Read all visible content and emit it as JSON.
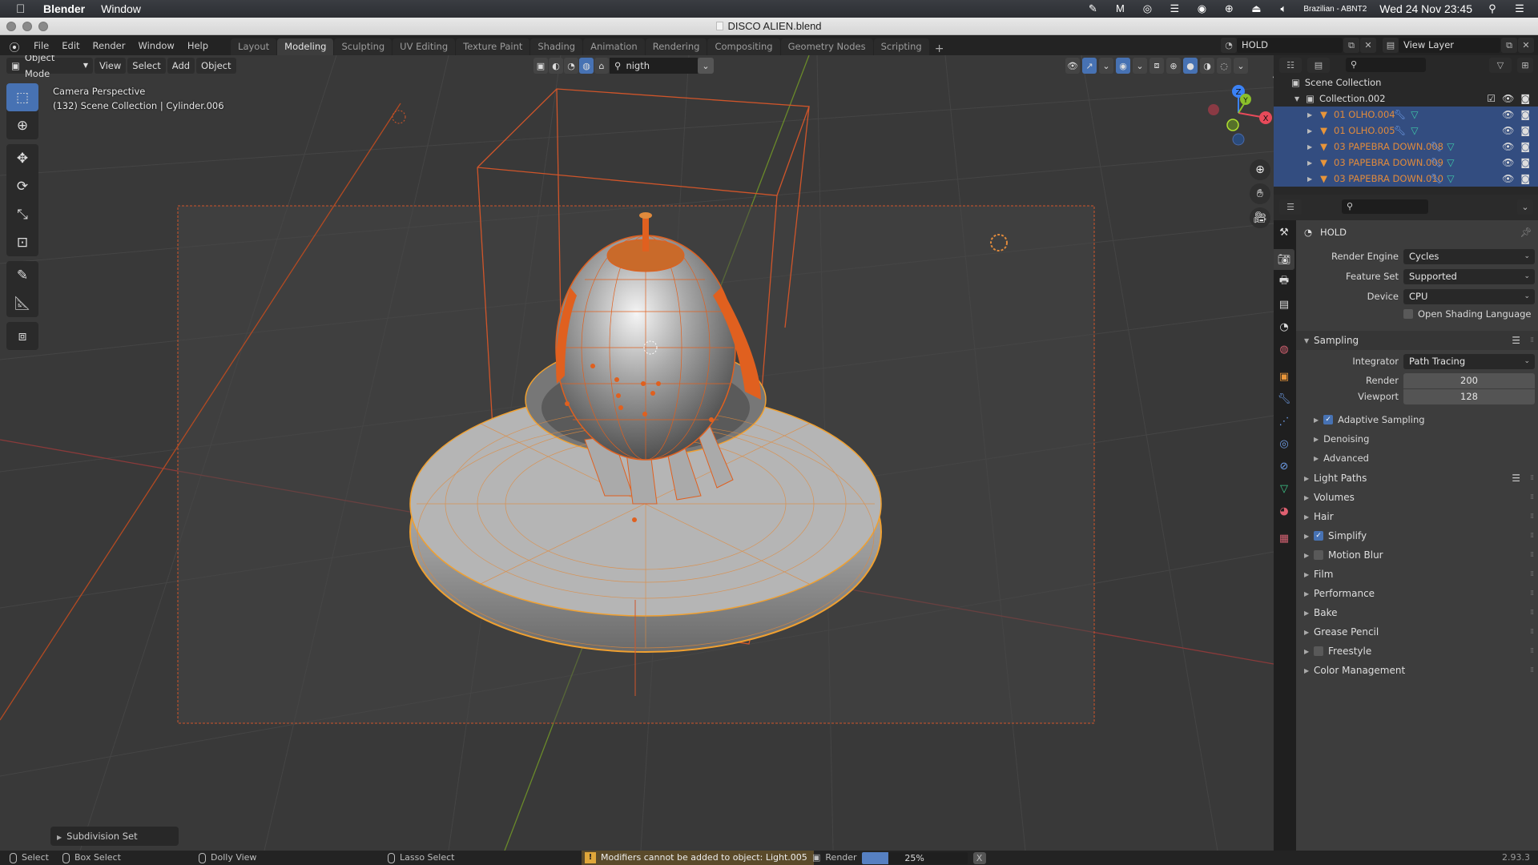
{
  "macos": {
    "app_name": "Blender",
    "menus": [
      "Window"
    ],
    "status_icons": [
      "notification-icon",
      "malwarebytes-icon",
      "creative-cloud-icon",
      "menu-app-icon",
      "nvidia-icon",
      "accessibility-icon",
      "eject-icon",
      "volume-icon"
    ],
    "keyboard_layout": "Brazilian - ABNT2",
    "clock": "Wed 24 Nov  23:45"
  },
  "window": {
    "title": "DISCO ALIEN.blend"
  },
  "topbar": {
    "menus": [
      "File",
      "Edit",
      "Render",
      "Window",
      "Help"
    ],
    "workspaces": [
      {
        "label": "Layout",
        "active": false
      },
      {
        "label": "Modeling",
        "active": true
      },
      {
        "label": "Sculpting",
        "active": false
      },
      {
        "label": "UV Editing",
        "active": false
      },
      {
        "label": "Texture Paint",
        "active": false
      },
      {
        "label": "Shading",
        "active": false
      },
      {
        "label": "Animation",
        "active": false
      },
      {
        "label": "Rendering",
        "active": false
      },
      {
        "label": "Compositing",
        "active": false
      },
      {
        "label": "Geometry Nodes",
        "active": false
      },
      {
        "label": "Scripting",
        "active": false
      }
    ],
    "add_workspace": "+",
    "scene": "HOLD",
    "view_layer": "View Layer"
  },
  "viewport": {
    "mode": "Object Mode",
    "menus": [
      "View",
      "Select",
      "Add",
      "Object"
    ],
    "filter_search": "nigth",
    "info_line1": "Camera Perspective",
    "info_line2": "(132) Scene Collection | Cylinder.006",
    "gizmo_axes": [
      "Z",
      "Y",
      "X"
    ],
    "last_operator": "Subdivision Set",
    "accent": "#4772b3",
    "selection_color": "#e8761f"
  },
  "outliner": {
    "root": "Scene Collection",
    "collection": "Collection.002",
    "items": [
      {
        "name": "01 OLHO.004",
        "selected": true
      },
      {
        "name": "01 OLHO.005",
        "selected": true
      },
      {
        "name": "03 PAPEBRA DOWN.008",
        "selected": true
      },
      {
        "name": "03 PAPEBRA DOWN.009",
        "selected": true
      },
      {
        "name": "03 PAPEBRA DOWN.010",
        "selected": true
      }
    ]
  },
  "properties": {
    "context": "HOLD",
    "render_engine_label": "Render Engine",
    "render_engine": "Cycles",
    "feature_set_label": "Feature Set",
    "feature_set": "Supported",
    "device_label": "Device",
    "device": "CPU",
    "osl_label": "Open Shading Language",
    "sampling": {
      "title": "Sampling",
      "integrator_label": "Integrator",
      "integrator": "Path Tracing",
      "render_label": "Render",
      "render": "200",
      "viewport_label": "Viewport",
      "viewport": "128",
      "adaptive": "Adaptive Sampling",
      "denoising": "Denoising",
      "advanced": "Advanced"
    },
    "panels": [
      {
        "label": "Light Paths",
        "checkbox": null
      },
      {
        "label": "Volumes",
        "checkbox": null
      },
      {
        "label": "Hair",
        "checkbox": null
      },
      {
        "label": "Simplify",
        "checkbox": true
      },
      {
        "label": "Motion Blur",
        "checkbox": false
      },
      {
        "label": "Film",
        "checkbox": null
      },
      {
        "label": "Performance",
        "checkbox": null
      },
      {
        "label": "Bake",
        "checkbox": null
      },
      {
        "label": "Grease Pencil",
        "checkbox": null
      },
      {
        "label": "Freestyle",
        "checkbox": false
      },
      {
        "label": "Color Management",
        "checkbox": null
      }
    ]
  },
  "statusbar": {
    "select": "Select",
    "box_select": "Box Select",
    "dolly": "Dolly View",
    "lasso": "Lasso Select",
    "warning": "Modifiers cannot be added to object: Light.005",
    "job": "Render",
    "progress_percent": 25,
    "progress_label": "25%",
    "cancel": "X",
    "version": "2.93.3"
  }
}
